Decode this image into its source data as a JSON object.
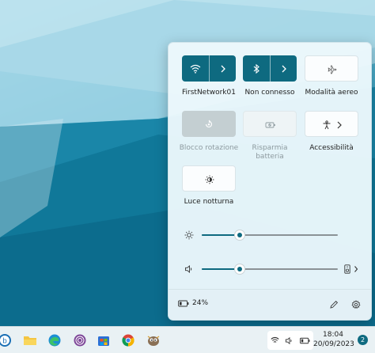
{
  "quick_settings": {
    "tiles": [
      {
        "label": "FirstNetwork01",
        "state": "on",
        "icon": "wifi-icon",
        "has_chevron": true
      },
      {
        "label": "Non connesso",
        "state": "on",
        "icon": "bluetooth-icon",
        "has_chevron": true
      },
      {
        "label": "Modalità aereo",
        "state": "off",
        "icon": "airplane-icon"
      },
      {
        "label": "Blocco rotazione",
        "state": "disabled",
        "icon": "rotation-lock-icon"
      },
      {
        "label": "Risparmia batteria",
        "state": "disabled",
        "icon": "battery-saver-icon"
      },
      {
        "label": "Accessibilità",
        "state": "off",
        "icon": "accessibility-icon",
        "has_chevron": true
      },
      {
        "label": "Luce notturna",
        "state": "off",
        "icon": "night-light-icon"
      }
    ],
    "brightness": {
      "icon": "brightness-icon",
      "value": 0.28
    },
    "volume": {
      "icon": "speaker-icon",
      "value": 0.28,
      "output_icon": "audio-output-icon"
    },
    "footer": {
      "battery_text": "24%",
      "battery_icon": "battery-icon",
      "edit_icon": "pencil-icon",
      "settings_icon": "gear-icon"
    }
  },
  "taskbar": {
    "apps": [
      "start-icon",
      "file-explorer-icon",
      "edge-icon",
      "tor-browser-icon",
      "microsoft-store-icon",
      "chrome-icon",
      "gimp-icon"
    ],
    "tray_icons": [
      "wifi-icon",
      "speaker-icon",
      "battery-icon"
    ],
    "time": "18:04",
    "date": "20/09/2023",
    "notifications_count": "2"
  },
  "colors": {
    "accent": "#0e6a80",
    "panel_bg": "#ecf8fc",
    "taskbar_bg": "#e9f1f4"
  }
}
